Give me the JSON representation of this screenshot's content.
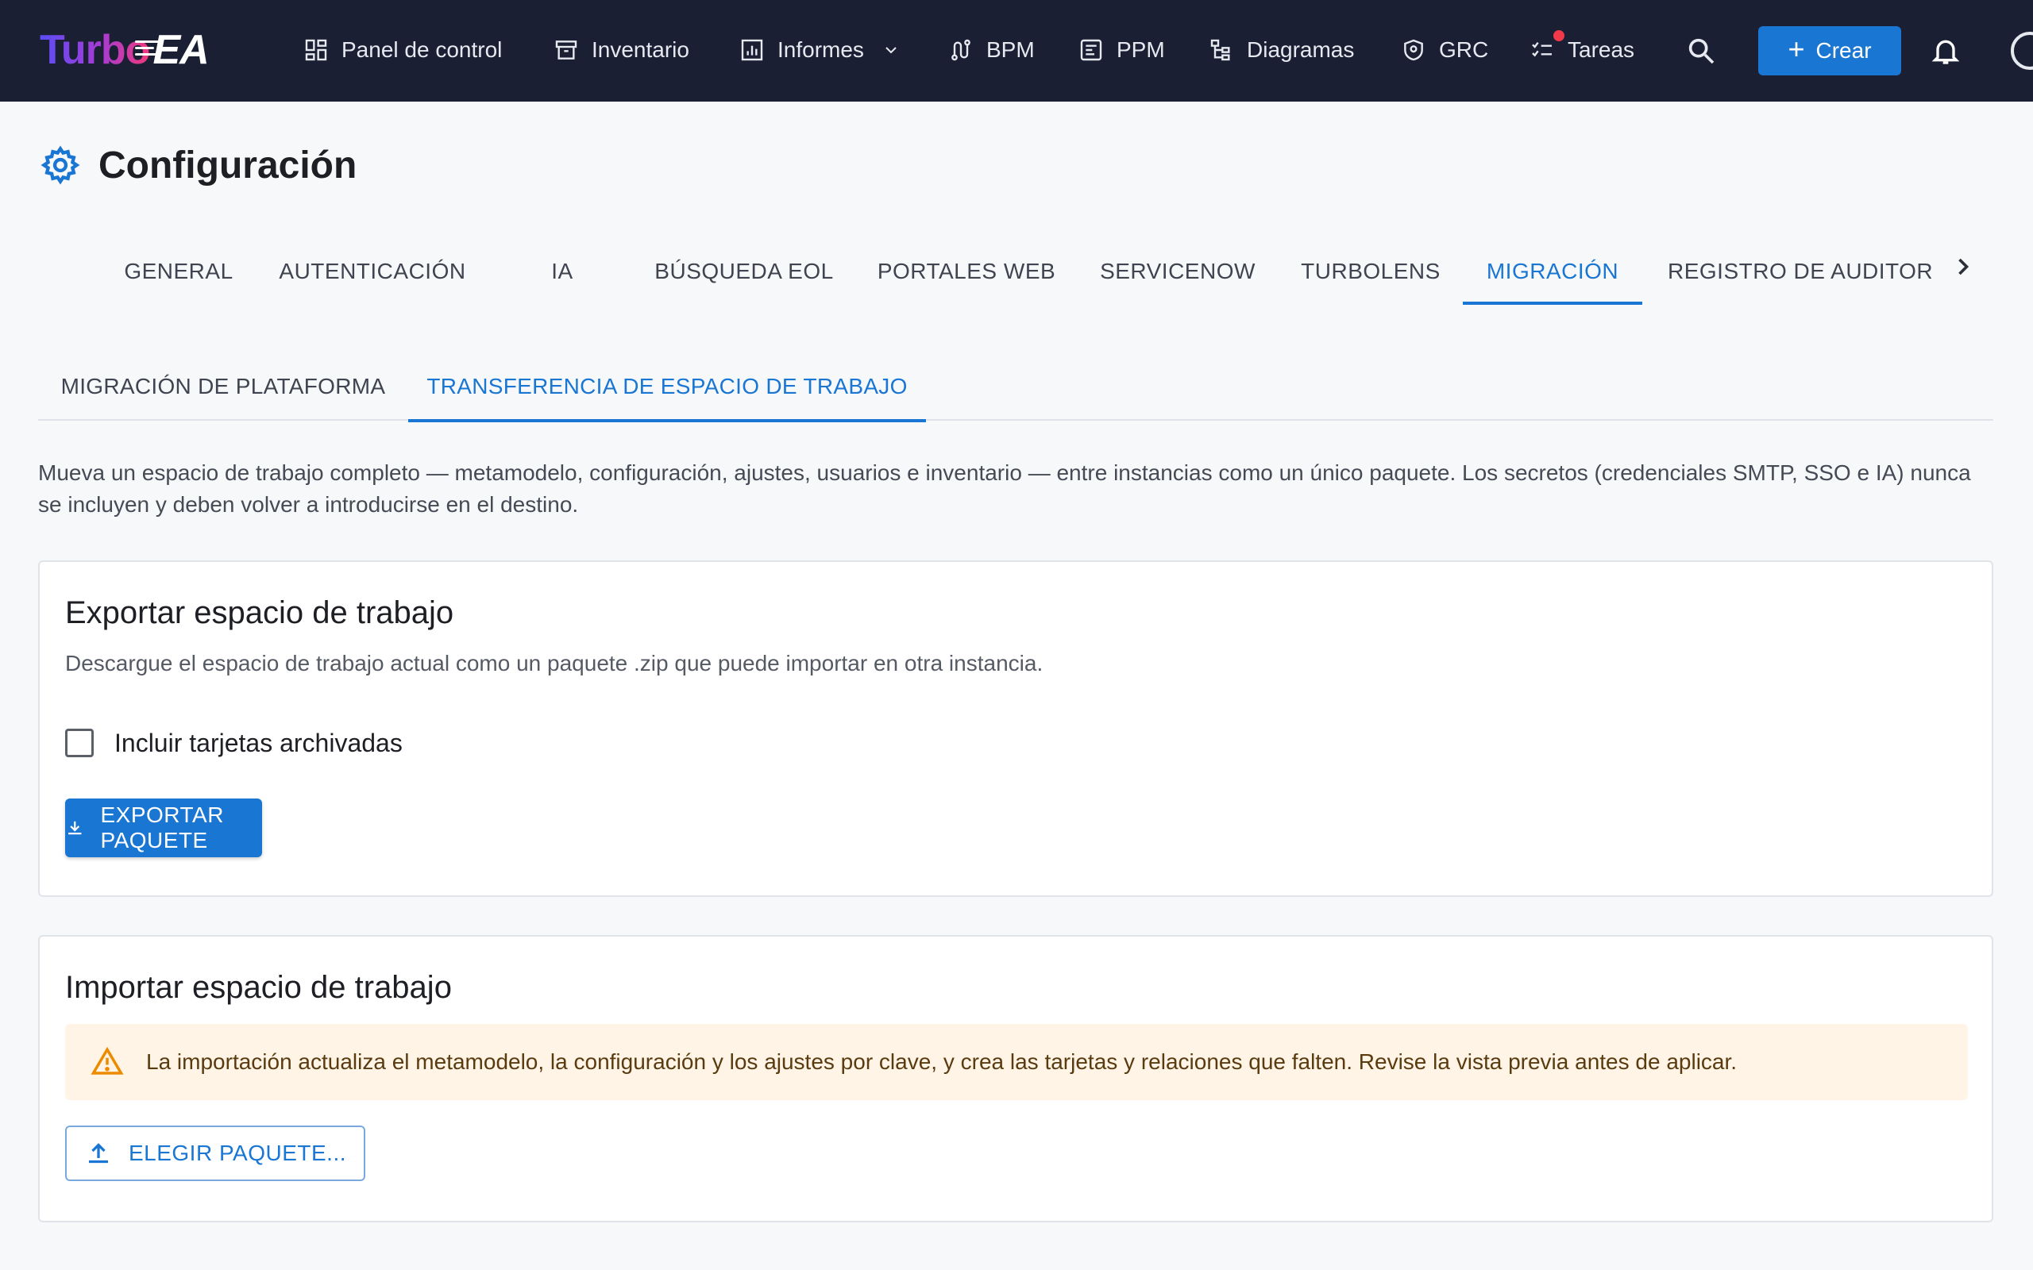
{
  "app": {
    "logo_turbo": "Turbo",
    "logo_ea": "EA"
  },
  "nav": {
    "items": [
      {
        "label": "Panel de control",
        "icon": "dashboard-icon"
      },
      {
        "label": "Inventario",
        "icon": "inventory-box-icon"
      },
      {
        "label": "Informes",
        "icon": "reports-chart-icon",
        "has_dropdown": true
      },
      {
        "label": "BPM",
        "icon": "process-route-icon"
      },
      {
        "label": "PPM",
        "icon": "project-icon"
      },
      {
        "label": "Diagramas",
        "icon": "diagram-tree-icon"
      },
      {
        "label": "GRC",
        "icon": "shield-icon"
      },
      {
        "label": "Tareas",
        "icon": "tasks-checklist-icon",
        "has_notification": true
      }
    ],
    "create_label": "Crear"
  },
  "page": {
    "title": "Configuración",
    "title_icon": "gear-icon"
  },
  "tabs": [
    {
      "label": "GENERAL",
      "active": false
    },
    {
      "label": "AUTENTICACIÓN",
      "active": false
    },
    {
      "label": "IA",
      "active": false
    },
    {
      "label": "BÚSQUEDA EOL",
      "active": false
    },
    {
      "label": "PORTALES WEB",
      "active": false
    },
    {
      "label": "SERVICENOW",
      "active": false
    },
    {
      "label": "TURBOLENS",
      "active": false
    },
    {
      "label": "MIGRACIÓN",
      "active": true
    },
    {
      "label": "REGISTRO DE AUDITORÍA",
      "active": false
    }
  ],
  "subtabs": [
    {
      "label": "MIGRACIÓN DE PLATAFORMA",
      "active": false
    },
    {
      "label": "TRANSFERENCIA DE ESPACIO DE TRABAJO",
      "active": true
    }
  ],
  "intro": "Mueva un espacio de trabajo completo — metamodelo, configuración, ajustes, usuarios e inventario — entre instancias como un único paquete. Los secretos (credenciales SMTP, SSO e IA) nunca se incluyen y deben volver a introducirse en el destino.",
  "export": {
    "title": "Exportar espacio de trabajo",
    "subtitle": "Descargue el espacio de trabajo actual como un paquete .zip que puede importar en otra instancia.",
    "checkbox_label": "Incluir tarjetas archivadas",
    "checkbox_checked": false,
    "button_label": "EXPORTAR PAQUETE"
  },
  "import": {
    "title": "Importar espacio de trabajo",
    "warning": "La importación actualiza el metamodelo, la configuración y los ajustes por clave, y crea las tarjetas y relaciones que falten. Revise la vista previa antes de aplicar.",
    "button_label": "ELEGIR PAQUETE..."
  },
  "colors": {
    "topbar": "#1a1f33",
    "accent": "#1976d2",
    "warning_bg": "#fff4e5",
    "warning_icon": "#ed8b00",
    "notification": "#f2394a"
  }
}
